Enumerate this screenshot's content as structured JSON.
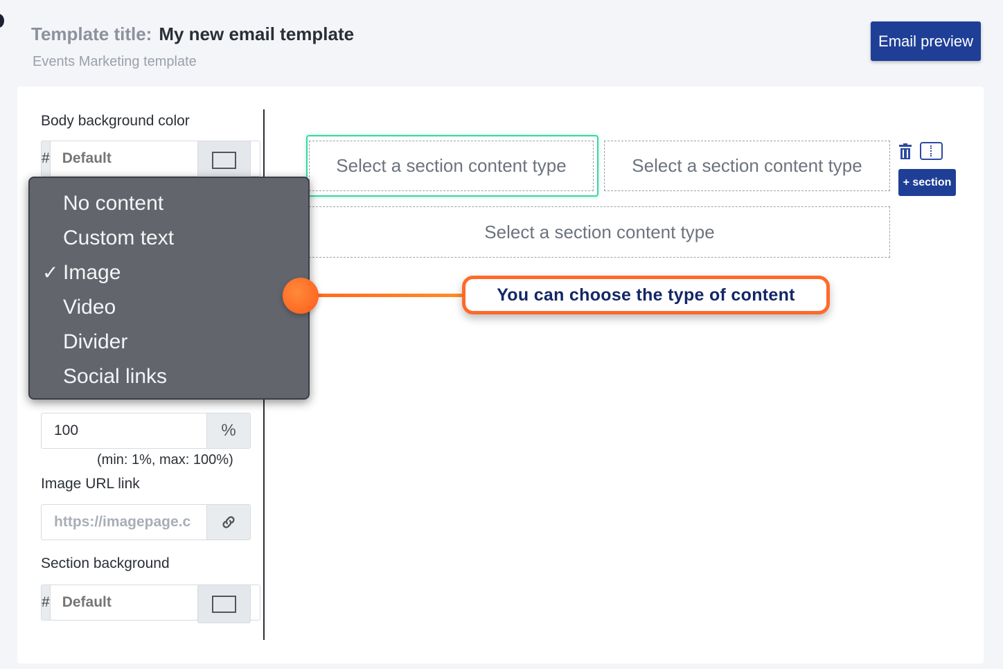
{
  "header": {
    "title_label": "Template title:",
    "title_value": "My new email template",
    "subtitle": "Events Marketing template",
    "preview_button": "Email preview"
  },
  "sidebar": {
    "body_bg_label": "Body background color",
    "hash_symbol": "#",
    "body_bg_placeholder": "Default",
    "width_value": "100",
    "width_unit": "%",
    "width_hint": "(min: 1%, max: 100%)",
    "image_url_label": "Image URL link",
    "image_url_value": "https://imagepage.c",
    "section_bg_label": "Section background",
    "section_bg_placeholder": "Default"
  },
  "dropdown": {
    "options": [
      "No content",
      "Custom text",
      "Image",
      "Video",
      "Divider",
      "Social links"
    ],
    "selected": "Image",
    "check_mark": "✓"
  },
  "canvas": {
    "section_placeholder": "Select a section content type",
    "add_section_button": "+ section",
    "icons": [
      "trash-icon",
      "columns-icon"
    ]
  },
  "callout": {
    "text": "You can choose the type of content"
  },
  "colors": {
    "primary": "#1f3f96",
    "selected_border": "#3ad6a4",
    "callout_orange": "#ff6a2a",
    "dropdown_bg": "#62656c"
  }
}
